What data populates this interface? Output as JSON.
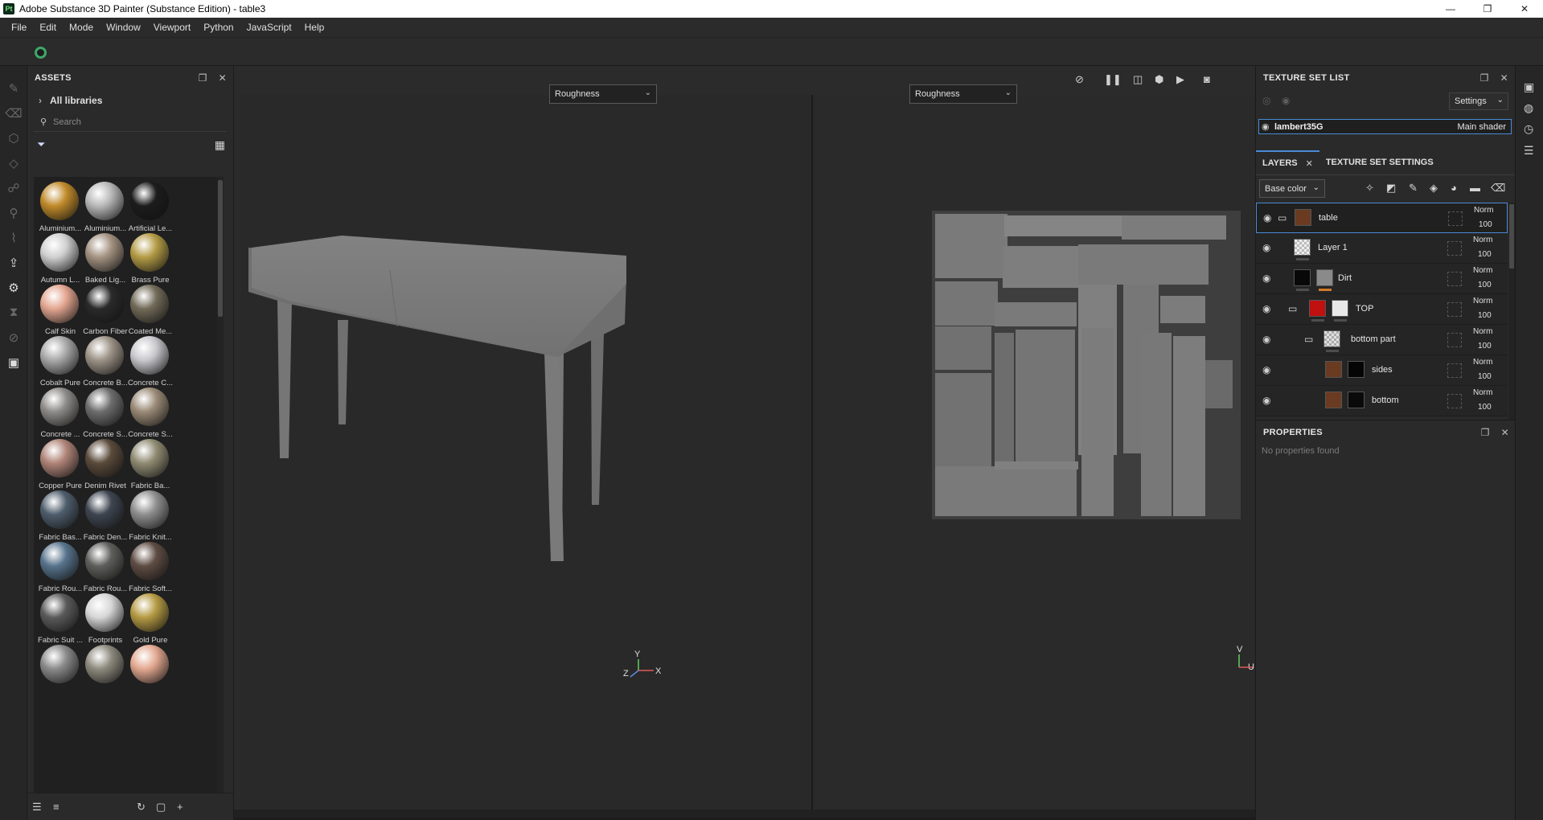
{
  "window": {
    "title": "Adobe Substance 3D Painter (Substance Edition) - table3",
    "app_badge": "Pt",
    "controls": [
      "—",
      "❐",
      "✕"
    ]
  },
  "menu": [
    "File",
    "Edit",
    "Mode",
    "Window",
    "Viewport",
    "Python",
    "JavaScript",
    "Help"
  ],
  "assets": {
    "title": "ASSETS",
    "library": "All libraries",
    "search_placeholder": "Search",
    "items": [
      {
        "label": "Aluminium...",
        "color": "#c08a2a"
      },
      {
        "label": "Aluminium...",
        "color": "#b8b8b8"
      },
      {
        "label": "Artificial Le...",
        "color": "#1c1c1c"
      },
      {
        "label": "Autumn L...",
        "color": "#cfcfcf"
      },
      {
        "label": "Baked Lig...",
        "color": "#a39281"
      },
      {
        "label": "Brass Pure",
        "color": "#b39b45"
      },
      {
        "label": "Calf Skin",
        "color": "#e3a690"
      },
      {
        "label": "Carbon Fiber",
        "color": "#2a2a2a"
      },
      {
        "label": "Coated Me...",
        "color": "#716a58"
      },
      {
        "label": "Cobalt Pure",
        "color": "#a9a9a9"
      },
      {
        "label": "Concrete B...",
        "color": "#9d9387"
      },
      {
        "label": "Concrete C...",
        "color": "#c8c8cc"
      },
      {
        "label": "Concrete ...",
        "color": "#8e8c8a"
      },
      {
        "label": "Concrete S...",
        "color": "#6d6d6d"
      },
      {
        "label": "Concrete S...",
        "color": "#9a8a76"
      },
      {
        "label": "Copper Pure",
        "color": "#b08478"
      },
      {
        "label": "Denim Rivet",
        "color": "#5a4a3a"
      },
      {
        "label": "Fabric Ba...",
        "color": "#8f8b72"
      },
      {
        "label": "Fabric Bas...",
        "color": "#4e5d6c"
      },
      {
        "label": "Fabric Den...",
        "color": "#3e4550"
      },
      {
        "label": "Fabric Knit...",
        "color": "#8e8e8e"
      },
      {
        "label": "Fabric Rou...",
        "color": "#57738c"
      },
      {
        "label": "Fabric Rou...",
        "color": "#5e5e5c"
      },
      {
        "label": "Fabric Soft...",
        "color": "#5e4c43"
      },
      {
        "label": "Fabric Suit ...",
        "color": "#5a5a5a"
      },
      {
        "label": "Footprints",
        "color": "#d6d6d6"
      },
      {
        "label": "Gold Pure",
        "color": "#b59a43"
      },
      {
        "label": "",
        "color": "#8a8a8a"
      },
      {
        "label": "",
        "color": "#8e8a7e"
      },
      {
        "label": "",
        "color": "#e3a890"
      }
    ]
  },
  "viewport": {
    "left_channel": "Roughness",
    "right_channel": "Roughness",
    "axes_3d": {
      "x": "X",
      "y": "Y",
      "z": "Z"
    },
    "axes_uv": {
      "v": "V",
      "u": "U"
    }
  },
  "texture_set_list": {
    "title": "TEXTURE SET LIST",
    "settings_label": "Settings",
    "set_name": "lambert35G",
    "shader": "Main shader"
  },
  "layers_panel": {
    "tab_layers": "LAYERS",
    "tab_settings": "TEXTURE SET SETTINGS",
    "channel": "Base color",
    "layers": [
      {
        "name": "table",
        "blend": "Norm",
        "opacity": "100"
      },
      {
        "name": "Layer 1",
        "blend": "Norm",
        "opacity": "100"
      },
      {
        "name": "Dirt",
        "blend": "Norm",
        "opacity": "100"
      },
      {
        "name": "TOP",
        "blend": "Norm",
        "opacity": "100"
      },
      {
        "name": "bottom part",
        "blend": "Norm",
        "opacity": "100"
      },
      {
        "name": "sides",
        "blend": "Norm",
        "opacity": "100"
      },
      {
        "name": "bottom",
        "blend": "Norm",
        "opacity": "100"
      }
    ]
  },
  "properties": {
    "title": "PROPERTIES",
    "empty_text": "No properties found"
  }
}
